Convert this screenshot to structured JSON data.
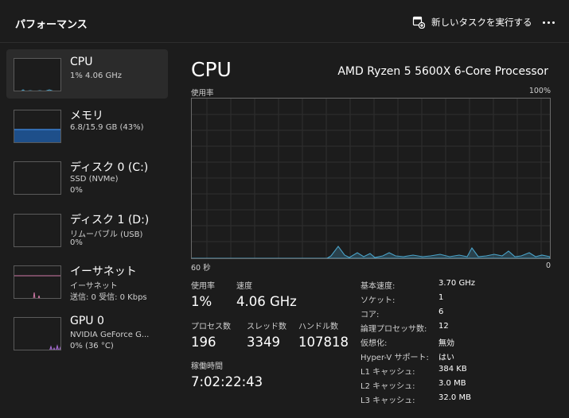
{
  "app": {
    "title": "パフォーマンス"
  },
  "toolbar": {
    "run_task_label": "新しいタスクを実行する",
    "run_task_icon": "run-task-icon",
    "more_icon": "more-icon"
  },
  "sidebar": {
    "items": [
      {
        "name": "CPU",
        "line1": "1%  4.06 GHz",
        "line2": "",
        "selected": true,
        "accent": "#4aa3c9"
      },
      {
        "name": "メモリ",
        "line1": "6.8/15.9 GB (43%)",
        "line2": "",
        "selected": false,
        "accent": "#3a7fd0"
      },
      {
        "name": "ディスク 0 (C:)",
        "line1": "SSD (NVMe)",
        "line2": "0%",
        "selected": false,
        "accent": "#4fae3f"
      },
      {
        "name": "ディスク 1 (D:)",
        "line1": "リムーバブル (USB)",
        "line2": "0%",
        "selected": false,
        "accent": "#4fae3f"
      },
      {
        "name": "イーサネット",
        "line1": "イーサネット",
        "line2": "送信: 0  受信: 0 Kbps",
        "selected": false,
        "accent": "#d27aa8"
      },
      {
        "name": "GPU 0",
        "line1": "NVIDIA GeForce G...",
        "line2": "0%  (36 °C)",
        "selected": false,
        "accent": "#a86cd6"
      }
    ]
  },
  "main": {
    "title": "CPU",
    "model": "AMD Ryzen 5 5600X 6-Core Processor",
    "graph": {
      "top_left": "使用率",
      "top_right": "100%",
      "bottom_left": "60 秒",
      "bottom_right": "0",
      "line_color": "#4aa3c9"
    },
    "stats": {
      "usage_label": "使用率",
      "usage_value": "1%",
      "speed_label": "速度",
      "speed_value": "4.06 GHz",
      "process_label": "プロセス数",
      "process_value": "196",
      "thread_label": "スレッド数",
      "thread_value": "3349",
      "handle_label": "ハンドル数",
      "handle_value": "107818",
      "uptime_label": "稼働時間",
      "uptime_value": "7:02:22:43"
    },
    "specs": [
      {
        "key": "基本速度:",
        "value": "3.70 GHz"
      },
      {
        "key": "ソケット:",
        "value": "1"
      },
      {
        "key": "コア:",
        "value": "6"
      },
      {
        "key": "論理プロセッサ数:",
        "value": "12"
      },
      {
        "key": "仮想化:",
        "value": "無効"
      },
      {
        "key": "Hyper-V サポート:",
        "value": "はい"
      },
      {
        "key": "L1 キャッシュ:",
        "value": "384 KB"
      },
      {
        "key": "L2 キャッシュ:",
        "value": "3.0 MB"
      },
      {
        "key": "L3 キャッシュ:",
        "value": "32.0 MB"
      }
    ]
  }
}
